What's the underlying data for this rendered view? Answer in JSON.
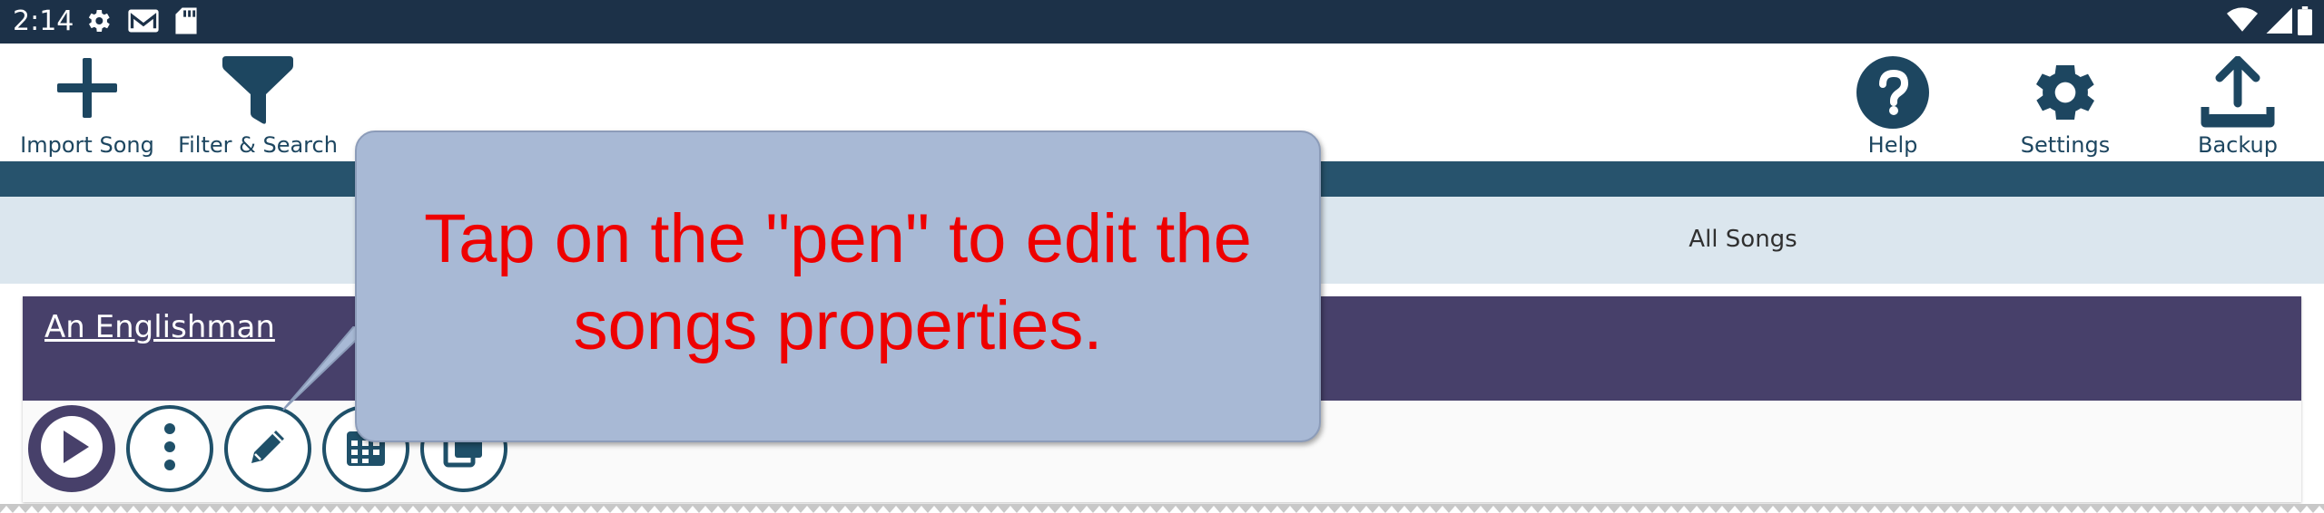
{
  "status_bar": {
    "time": "2:14",
    "left_icons": [
      "gear-icon",
      "gmail-icon",
      "sd-card-icon"
    ],
    "right_icons": [
      "wifi-icon",
      "signal-icon",
      "battery-icon"
    ]
  },
  "toolbar": {
    "import_label": "Import Song",
    "filter_label": "Filter & Search",
    "help_label": "Help",
    "settings_label": "Settings",
    "backup_label": "Backup"
  },
  "filter_bar": {
    "label": "All Songs"
  },
  "song": {
    "title": "An Englishman",
    "action_icons": [
      "play-icon",
      "more-vertical-icon",
      "pen-icon",
      "calendar-icon",
      "copy-icon"
    ]
  },
  "tooltip": {
    "text": "Tap on the \"pen\" to edit the songs properties."
  },
  "colors": {
    "status_bar": "#1c3148",
    "toolbar_icon": "#1d4660",
    "stripe": "#27536d",
    "filter_band": "#dbe6ee",
    "song_header": "#47406a",
    "tooltip_bg": "#a8b9d5",
    "tooltip_text": "#ee0000"
  }
}
